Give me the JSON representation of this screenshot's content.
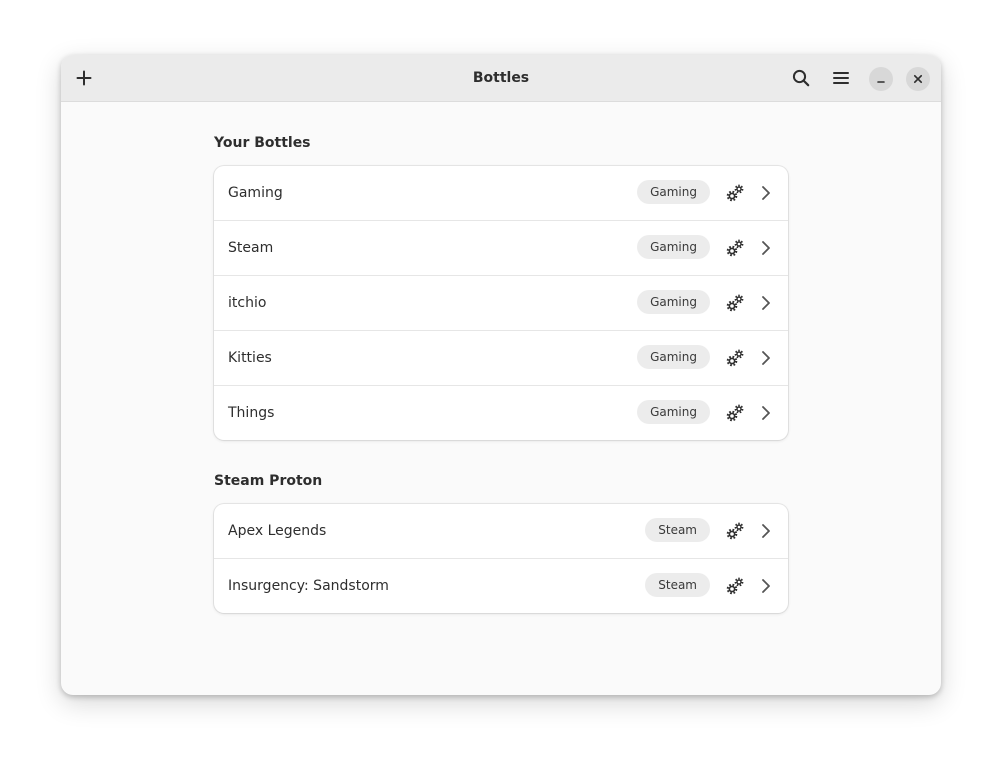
{
  "window": {
    "title": "Bottles"
  },
  "headerbar": {
    "add_icon": "plus-icon",
    "search_icon": "search-icon",
    "menu_icon": "hamburger-menu-icon",
    "minimize_icon": "minimize-icon",
    "close_icon": "close-icon"
  },
  "sections": [
    {
      "title": "Your Bottles",
      "rows": [
        {
          "name": "Gaming",
          "tag": "Gaming"
        },
        {
          "name": "Steam",
          "tag": "Gaming"
        },
        {
          "name": "itchio",
          "tag": "Gaming"
        },
        {
          "name": "Kitties",
          "tag": "Gaming"
        },
        {
          "name": "Things",
          "tag": "Gaming"
        }
      ]
    },
    {
      "title": "Steam Proton",
      "rows": [
        {
          "name": "Apex Legends",
          "tag": "Steam"
        },
        {
          "name": "Insurgency: Sandstorm",
          "tag": "Steam"
        }
      ]
    }
  ],
  "row_icons": {
    "settings_icon": "gears-icon",
    "open_icon": "chevron-right-icon"
  },
  "colors": {
    "headerbar_bg": "#ebebeb",
    "window_bg": "#fafafa",
    "card_bg": "#ffffff",
    "pill_bg": "#ececec",
    "text": "#2e2e2e"
  }
}
